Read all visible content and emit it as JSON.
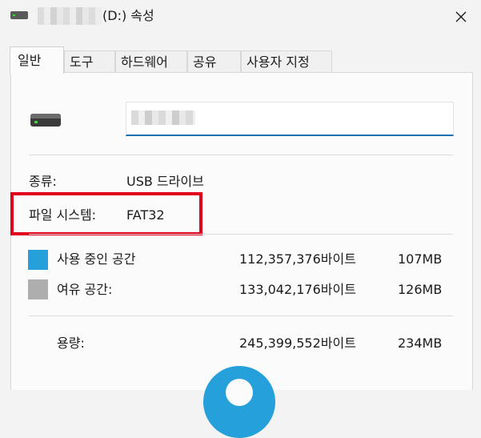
{
  "window": {
    "title": "(D:) 속성"
  },
  "tabs": [
    {
      "label": "일반",
      "active": true
    },
    {
      "label": "도구",
      "active": false
    },
    {
      "label": "하드웨어",
      "active": false
    },
    {
      "label": "공유",
      "active": false
    },
    {
      "label": "사용자 지정",
      "active": false
    }
  ],
  "general": {
    "type_label": "종류:",
    "type_value": "USB 드라이브",
    "fs_label": "파일 시스템:",
    "fs_value": "FAT32",
    "used_label": "사용 중인 공간",
    "used_bytes": "112,357,376바이트",
    "used_size": "107MB",
    "free_label": "여유 공간:",
    "free_bytes": "133,042,176바이트",
    "free_size": "126MB",
    "capacity_label": "용량:",
    "capacity_bytes": "245,399,552바이트",
    "capacity_size": "234MB"
  },
  "colors": {
    "used": "#26a0da",
    "free": "#aeaeae",
    "highlight": "#e0001b",
    "input_focus": "#1a6fb0"
  },
  "icons": {
    "drive": "usb-drive-icon",
    "close": "close-icon"
  }
}
